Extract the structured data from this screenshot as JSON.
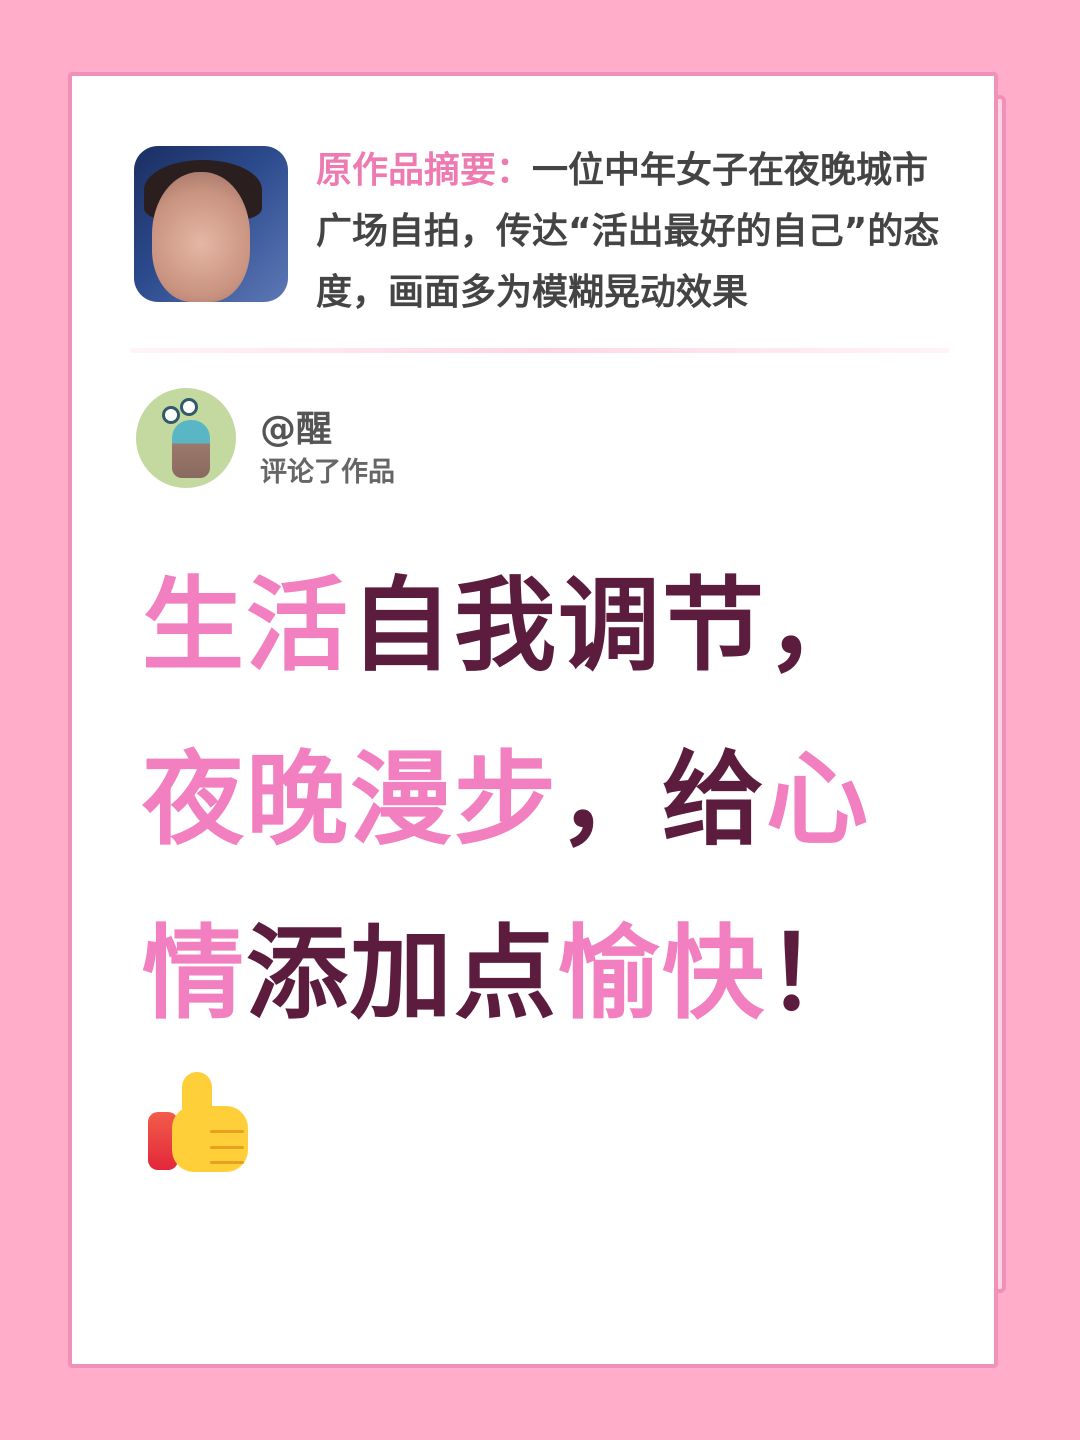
{
  "summary": {
    "label": "原作品摘要：",
    "text": "一位中年女子在夜晚城市广场自拍，传达“活出最好的自己”的态度，画面多为模糊晃动效果"
  },
  "comment": {
    "username": "@醒",
    "action": "评论了作品"
  },
  "headline": {
    "segments": [
      {
        "text": "生活",
        "color": "pink"
      },
      {
        "text": "自我调节，",
        "color": "dark"
      },
      {
        "text": "夜晚漫步",
        "color": "pink"
      },
      {
        "text": "，给",
        "color": "dark"
      },
      {
        "text": "心情",
        "color": "pink"
      },
      {
        "text": "添加点",
        "color": "dark"
      },
      {
        "text": "愉快",
        "color": "pink"
      },
      {
        "text": "！",
        "color": "dark"
      }
    ]
  },
  "colors": {
    "background": "#ffadc8",
    "accent_pink": "#f27fc0",
    "dark_text": "#5c1c3e",
    "label_pink": "#ee7ab2"
  },
  "icons": {
    "reaction": "thumbs-up-icon"
  }
}
